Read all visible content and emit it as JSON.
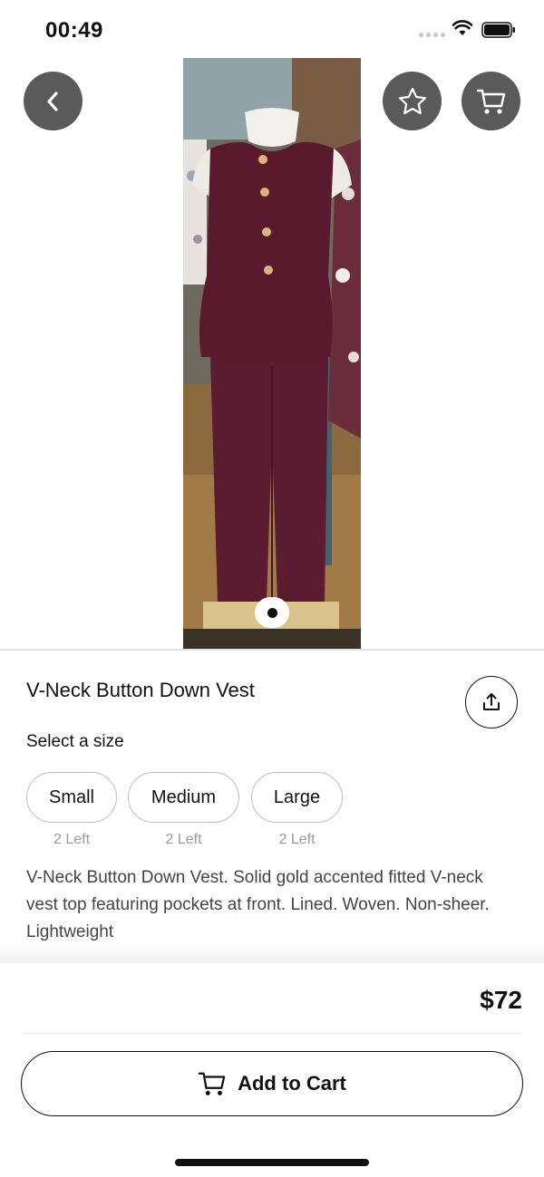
{
  "status_bar": {
    "time": "00:49"
  },
  "hero": {
    "back_icon": "chevron-left-icon",
    "favorite_icon": "star-outline-icon",
    "cart_icon": "cart-icon",
    "image_count": 1,
    "active_image": 1
  },
  "product": {
    "title": "V-Neck Button Down Vest",
    "share_icon": "share-upload-icon",
    "size_prompt": "Select a size",
    "sizes": [
      {
        "label": "Small",
        "stock": "2 Left"
      },
      {
        "label": "Medium",
        "stock": "2 Left"
      },
      {
        "label": "Large",
        "stock": "2 Left"
      }
    ],
    "description": "V-Neck Button Down Vest. Solid gold accented fitted V-neck vest top featuring pockets at front. Lined. Woven. Non-sheer. Lightweight"
  },
  "footer": {
    "price": "$72",
    "add_to_cart_label": "Add to Cart"
  },
  "colors": {
    "overlay_button": "#5a5a5a",
    "garment": "#5a1a2e",
    "text_primary": "#111111",
    "text_muted": "#9a9a9a"
  }
}
